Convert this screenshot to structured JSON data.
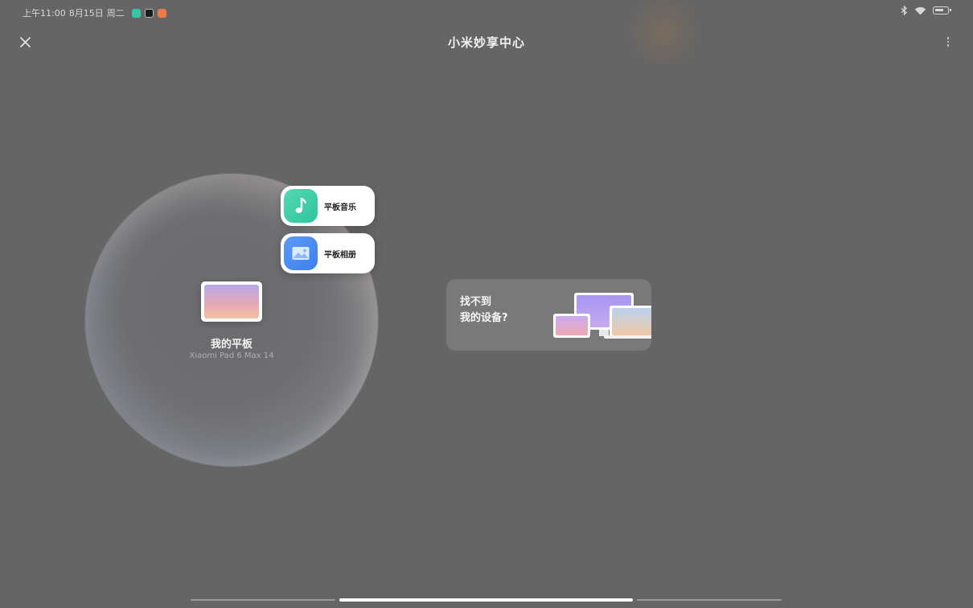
{
  "status_bar": {
    "time": "上午11:00",
    "date": "8月15日",
    "weekday": "周二",
    "app_icons": [
      "wechat-icon",
      "tiktok-icon",
      "orange-app-icon"
    ],
    "right_icons": [
      "bluetooth-icon",
      "wifi-icon",
      "battery-icon"
    ]
  },
  "header": {
    "title": "小米妙享中心"
  },
  "device": {
    "name": "我的平板",
    "model": "Xiaomi Pad 6 Max 14"
  },
  "apps": [
    {
      "label": "平板音乐",
      "icon": "music-note-icon"
    },
    {
      "label": "平板相册",
      "icon": "photo-album-icon"
    }
  ],
  "help_card": {
    "title_line1": "找不到",
    "title_line2": "我的设备?"
  },
  "pager": {
    "page_count": 3,
    "active_index": 1
  },
  "colors": {
    "background": "#656565",
    "music_app": "#3ecba5",
    "album_app": "#4a8df3"
  }
}
